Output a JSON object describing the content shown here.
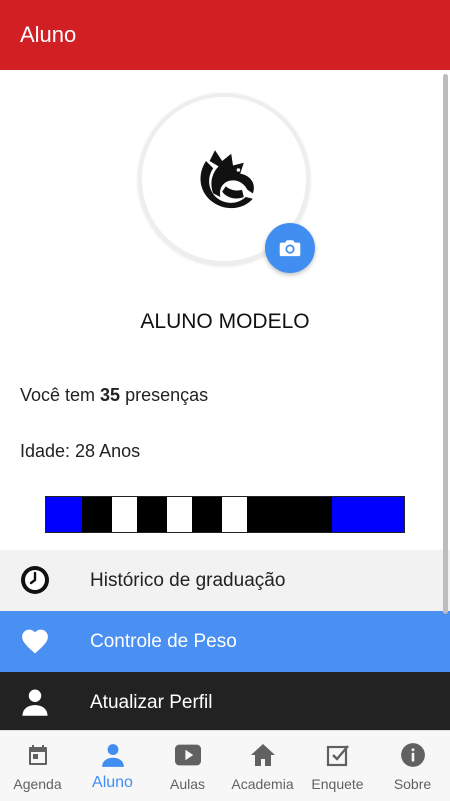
{
  "app_bar": {
    "title": "Aluno",
    "color": "#d11f24"
  },
  "profile": {
    "name": "ALUNO MODELO",
    "presencas_prefix": "Você tem ",
    "presencas_count": "35",
    "presencas_suffix": " presenças",
    "idade": "Idade: 28 Anos",
    "logo_icon": "dragon-logo",
    "camera_icon": "camera-icon"
  },
  "belt": {
    "colors": [
      "#0000ff",
      "#000000",
      "#ffffff",
      "#000000",
      "#ffffff",
      "#000000",
      "#ffffff",
      "#000000",
      "#0000ff"
    ],
    "stripes": 3
  },
  "menu": [
    {
      "label": "Histórico de graduação",
      "icon": "clock-icon",
      "bg": "#f2f2f2",
      "fg": "#222222"
    },
    {
      "label": "Controle de Peso",
      "icon": "heart-icon",
      "bg": "#4a8ff2",
      "fg": "#ffffff"
    },
    {
      "label": "Atualizar Perfil",
      "icon": "person-icon",
      "bg": "#222222",
      "fg": "#ffffff"
    }
  ],
  "bottom_nav": {
    "active": "Aluno",
    "active_color": "#3f8ef0",
    "tabs": [
      {
        "label": "Agenda",
        "icon": "calendar-icon"
      },
      {
        "label": "Aluno",
        "icon": "person-icon"
      },
      {
        "label": "Aulas",
        "icon": "video-play-icon"
      },
      {
        "label": "Academia",
        "icon": "home-icon"
      },
      {
        "label": "Enquete",
        "icon": "checkbox-icon"
      },
      {
        "label": "Sobre",
        "icon": "info-icon"
      }
    ]
  }
}
